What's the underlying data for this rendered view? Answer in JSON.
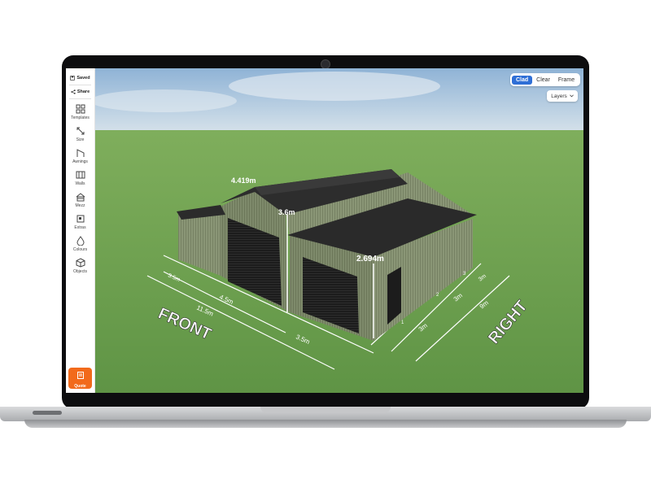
{
  "sidebar": {
    "saved_label": "Saved",
    "share_label": "Share",
    "items": [
      {
        "label": "Templates",
        "icon": "grid-icon"
      },
      {
        "label": "Size",
        "icon": "resize-icon"
      },
      {
        "label": "Awnings",
        "icon": "awning-icon"
      },
      {
        "label": "Walls",
        "icon": "walls-icon"
      },
      {
        "label": "Mezz",
        "icon": "mezzanine-icon"
      },
      {
        "label": "Extras",
        "icon": "extras-icon"
      },
      {
        "label": "Colours",
        "icon": "colour-drop-icon"
      },
      {
        "label": "Objects",
        "icon": "cube-icon"
      }
    ],
    "quote_label": "Quote"
  },
  "view_toggle": {
    "options": [
      "Clad",
      "Clear",
      "Frame"
    ],
    "active": "Clad"
  },
  "layers_label": "Layers",
  "dimensions": {
    "ridge_height": "4.419m",
    "main_wall_height": "3.6m",
    "lean_to_height": "2.694m",
    "front_bay_1": "3.5m",
    "front_bay_2": "4.5m",
    "front_total": "11.5m",
    "front_bay_3": "3.5m",
    "right_bay_1": "3m",
    "right_bay_2": "3m",
    "right_bay_3": "3m",
    "right_total": "9m"
  },
  "bay_numbers": [
    "1",
    "2",
    "3"
  ],
  "side_labels": {
    "front": "FRONT",
    "right": "RIGHT"
  },
  "colors": {
    "accent_blue": "#2f6fd6",
    "quote_orange": "#f26a1b",
    "wall_green": "#7d8a6a",
    "roof_dark": "#2b2b2b",
    "grass": "#6fa052"
  }
}
